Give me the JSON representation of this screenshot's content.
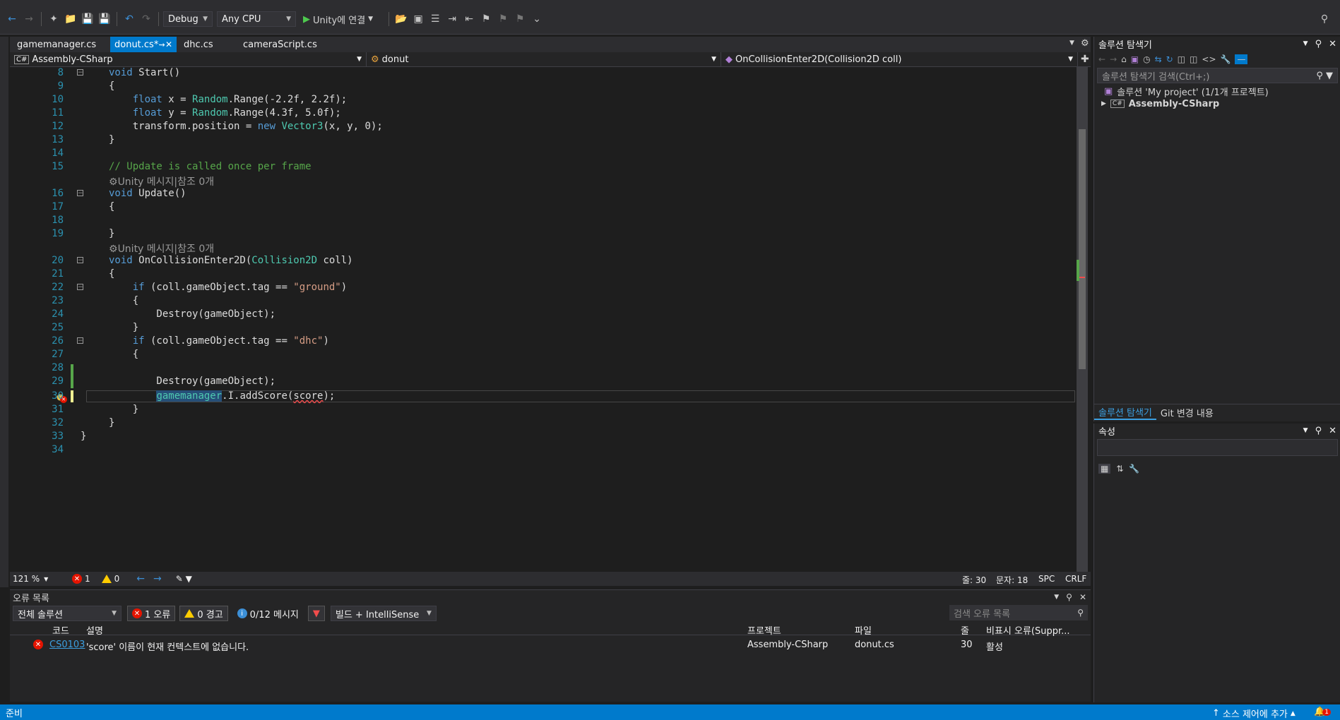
{
  "toolbar": {
    "config": "Debug",
    "platform": "Any CPU",
    "run_label": "Unity에 연결"
  },
  "tabs": [
    {
      "label": "gamemanager.cs"
    },
    {
      "label": "donut.cs*"
    },
    {
      "label": "dhc.cs"
    },
    {
      "label": "cameraScript.cs"
    }
  ],
  "navbar": {
    "project": "Assembly-CSharp",
    "class": "donut",
    "member": "OnCollisionEnter2D(Collision2D coll)"
  },
  "code": {
    "line_numbers": [
      "8",
      "9",
      "10",
      "11",
      "12",
      "13",
      "14",
      "15",
      "16",
      "17",
      "18",
      "19",
      "20",
      "21",
      "22",
      "23",
      "24",
      "25",
      "26",
      "27",
      "28",
      "29",
      "30",
      "31",
      "32",
      "33",
      "34"
    ],
    "hint": "Unity 메시지|참조 0개",
    "comment": "// Update is called once per frame",
    "ground": "\"ground\"",
    "dhc": "\"dhc\""
  },
  "editor_status": {
    "zoom": "121 %",
    "errors": "1",
    "warnings": "0",
    "line": "줄: 30",
    "col": "문자: 18",
    "spc": "SPC",
    "crlf": "CRLF"
  },
  "error_list": {
    "title": "오류 목록",
    "scope": "전체 솔루션",
    "errors_btn": "1 오류",
    "warnings_btn": "0 경고",
    "messages_btn": "0/12 메시지",
    "build_filter": "빌드 + IntelliSense",
    "search_placeholder": "검색 오류 목록",
    "headers": {
      "code": "코드",
      "desc": "설명",
      "project": "프로젝트",
      "file": "파일",
      "line": "줄",
      "suppress": "비표시 오류(Suppr..."
    },
    "rows": [
      {
        "code": "CS0103",
        "desc": "'score' 이름이 현재 컨텍스트에 없습니다.",
        "project": "Assembly-CSharp",
        "file": "donut.cs",
        "line": "30",
        "state": "활성"
      }
    ]
  },
  "solution_explorer": {
    "title": "솔루션 탐색기",
    "search": "솔루션 탐색기 검색(Ctrl+;)",
    "solution": "솔루션 'My project' (1/1개 프로젝트)",
    "project": "Assembly-CSharp",
    "tab1": "솔루션 탐색기",
    "tab2": "Git 변경 내용"
  },
  "properties": {
    "title": "속성"
  },
  "statusbar": {
    "ready": "준비",
    "source_control": "소스 제어에 추가",
    "notify_count": "1"
  }
}
